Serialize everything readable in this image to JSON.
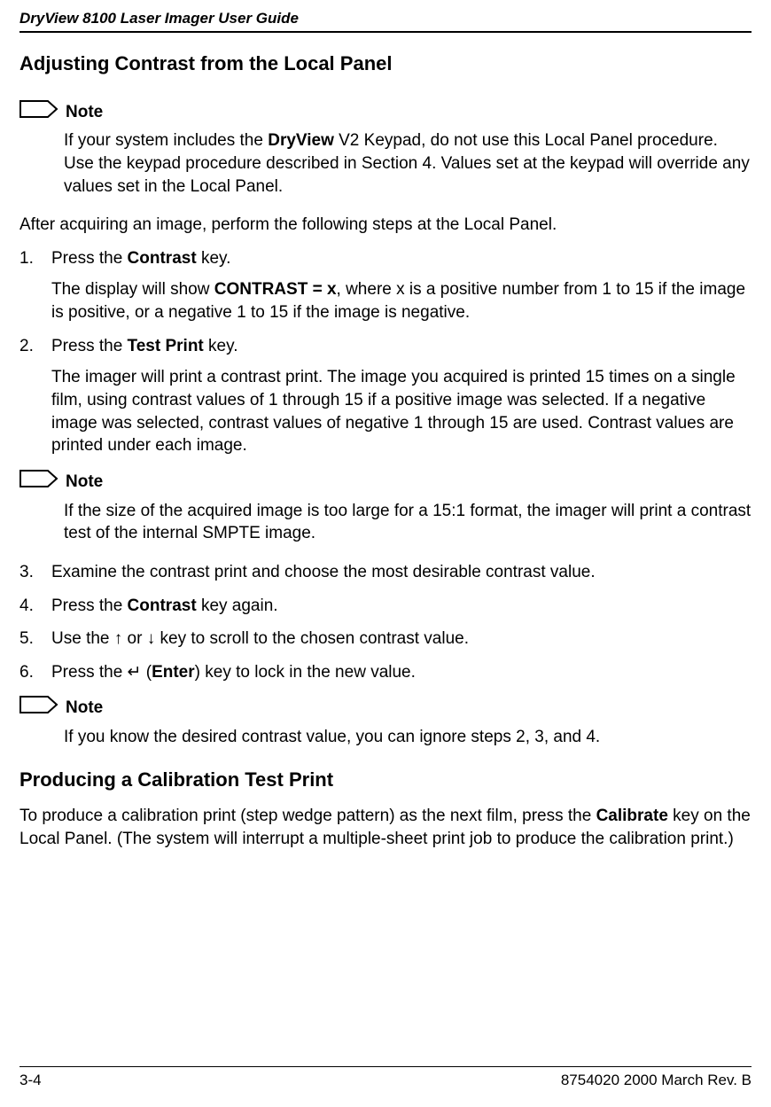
{
  "header": {
    "title": "DryView 8100 Laser Imager User Guide"
  },
  "section1": {
    "title": "Adjusting Contrast from the Local Panel"
  },
  "note1": {
    "label": "Note",
    "body_pre": "If your system includes the ",
    "body_bold": "DryView",
    "body_post": " V2 Keypad, do not use this Local Panel procedure. Use the keypad procedure described in Section 4. Values set at the keypad will override any values set in the Local Panel."
  },
  "intro": "After acquiring an image, perform the following steps at the Local Panel.",
  "steps_a": [
    {
      "pre": "Press the ",
      "bold": "Contrast",
      "post": " key.",
      "sub_pre": "The display will show ",
      "sub_bold": "CONTRAST = x",
      "sub_post": ", where x is a positive number from 1 to 15 if the image is positive, or a negative 1 to 15 if the image is negative."
    },
    {
      "pre": "Press the ",
      "bold": "Test Print",
      "post": " key.",
      "sub": "The imager will print a contrast print.  The image you acquired is printed 15 times on a single film, using contrast values of 1 through 15 if a positive image was selected.  If a negative image was selected, contrast values of negative 1 through 15 are used. Contrast values are printed under each image."
    }
  ],
  "note2": {
    "label": "Note",
    "body": "If the size of the acquired image is too large for a 15:1 format, the imager will print a contrast test of the internal SMPTE image."
  },
  "steps_b": {
    "s3": "Examine the contrast print and choose the most desirable contrast value.",
    "s4_pre": "Press the ",
    "s4_bold": "Contrast",
    "s4_post": " key again.",
    "s5_pre": "Use the ",
    "s5_up": "↑",
    "s5_mid": " or ",
    "s5_down": "↓",
    "s5_post": " key to scroll to the chosen contrast value.",
    "s6_pre": "Press the ",
    "s6_enter_sym": "↵",
    "s6_open": " (",
    "s6_bold": "Enter",
    "s6_post": ") key to lock in the new value."
  },
  "note3": {
    "label": "Note",
    "body": "If you know the desired contrast value, you can ignore steps 2, 3, and 4."
  },
  "section2": {
    "title": "Producing a Calibration Test Print",
    "body_pre": "To produce a calibration print (step wedge pattern) as the next film, press the ",
    "body_bold": "Calibrate",
    "body_post": " key on the Local Panel. (The system will interrupt a multiple-sheet print job to produce the calibration print.)"
  },
  "footer": {
    "page": "3-4",
    "right": "8754020    2000 March Rev. B"
  }
}
